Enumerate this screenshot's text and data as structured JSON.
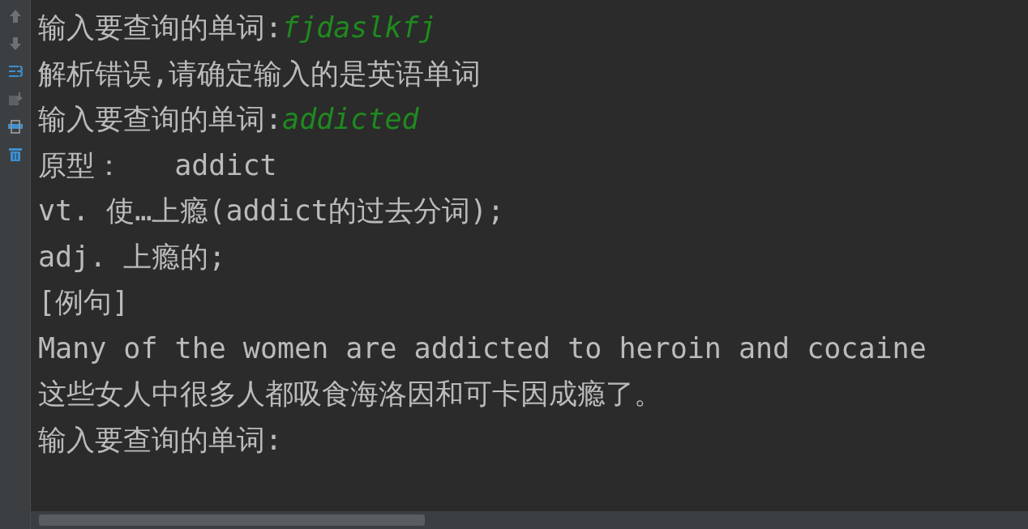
{
  "console": {
    "lines": [
      {
        "text": "输入要查询的单词:",
        "input": "fjdaslkfj"
      },
      {
        "text": "解析错误,请确定输入的是英语单词"
      },
      {
        "text": "输入要查询的单词:",
        "input": "addicted"
      },
      {
        "text": "原型：   addict"
      },
      {
        "text": "vt. 使…上瘾(addict的过去分词);"
      },
      {
        "text": "adj. 上瘾的;"
      },
      {
        "text": "[例句]"
      },
      {
        "text": "Many of the women are addicted to heroin and cocaine"
      },
      {
        "text": "这些女人中很多人都吸食海洛因和可卡因成瘾了。"
      },
      {
        "text": "输入要查询的单词:"
      }
    ]
  }
}
